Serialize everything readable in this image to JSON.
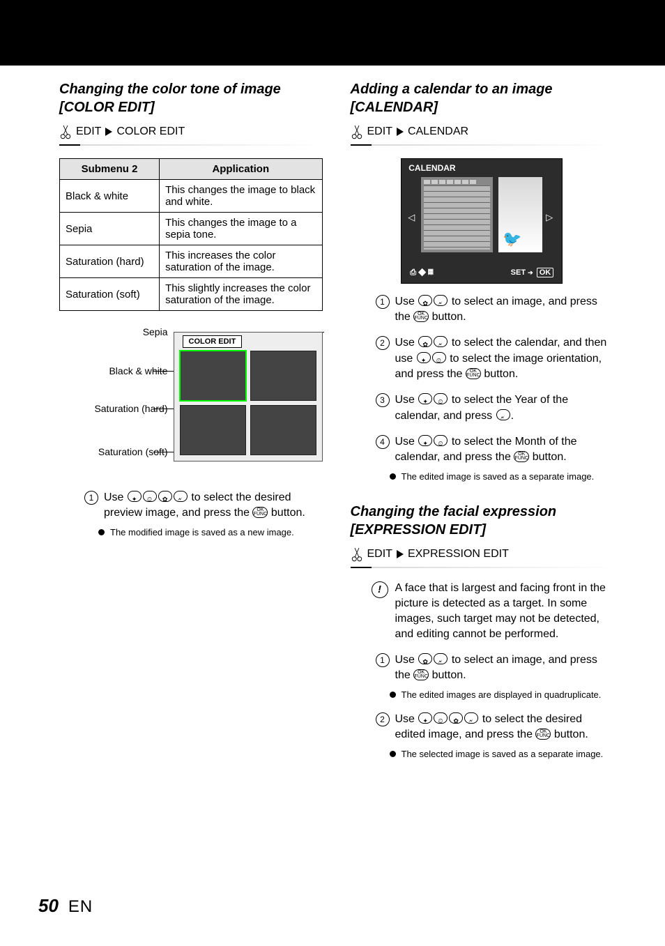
{
  "page_number": "50",
  "page_lang": "EN",
  "left": {
    "title": "Changing the color tone of image [COLOR EDIT]",
    "crumb_root": "EDIT",
    "crumb_leaf": "COLOR EDIT",
    "table": {
      "h1": "Submenu 2",
      "h2": "Application",
      "rows": [
        {
          "a": "Black & white",
          "b": "This changes the image to black and white."
        },
        {
          "a": "Sepia",
          "b": "This changes the image to a sepia tone."
        },
        {
          "a": "Saturation (hard)",
          "b": "This increases the color saturation of the image."
        },
        {
          "a": "Saturation (soft)",
          "b": "This slightly increases the color saturation of the image."
        }
      ]
    },
    "diagram": {
      "l1": "Sepia",
      "l2": "Black & white",
      "l3": "Saturation (hard)",
      "l4": "Saturation (soft)",
      "box_title": "COLOR EDIT"
    },
    "step1_a": "Use ",
    "step1_b": " to select the desired preview image, and press the ",
    "step1_c": " button.",
    "bullet1": "The modified image is saved as a new image."
  },
  "right1": {
    "title": "Adding a calendar to an image [CALENDAR]",
    "crumb_root": "EDIT",
    "crumb_leaf": "CALENDAR",
    "calbox_title": "CALENDAR",
    "footer_left": "⎙ ◆ 𝄜",
    "footer_set": "SET",
    "footer_ok": "OK",
    "s1a": "Use ",
    "s1b": " to select an image, and press the ",
    "s1c": " button.",
    "s2a": "Use ",
    "s2b": " to select the calendar, and then use ",
    "s2c": " to select the image orientation, and press the ",
    "s2d": " button.",
    "s3a": "Use ",
    "s3b": " to select the Year of the calendar, and press ",
    "s3c": ".",
    "s4a": "Use ",
    "s4b": " to select the Month of the calendar, and press the ",
    "s4c": " button.",
    "bullet": "The edited image is saved as a separate image."
  },
  "right2": {
    "title": "Changing the facial expression [EXPRESSION EDIT]",
    "crumb_root": "EDIT",
    "crumb_leaf": "EXPRESSION EDIT",
    "warn": "A face that is largest and facing front in the picture is detected as a target. In some images, such target may not be detected, and editing cannot be performed.",
    "s1a": "Use ",
    "s1b": " to select an image, and press the ",
    "s1c": " button.",
    "bullet1": "The edited images are displayed in quadruplicate.",
    "s2a": "Use ",
    "s2b": " to select the desired edited image, and press the ",
    "s2c": " button.",
    "bullet2": "The selected image is saved as a separate image."
  }
}
